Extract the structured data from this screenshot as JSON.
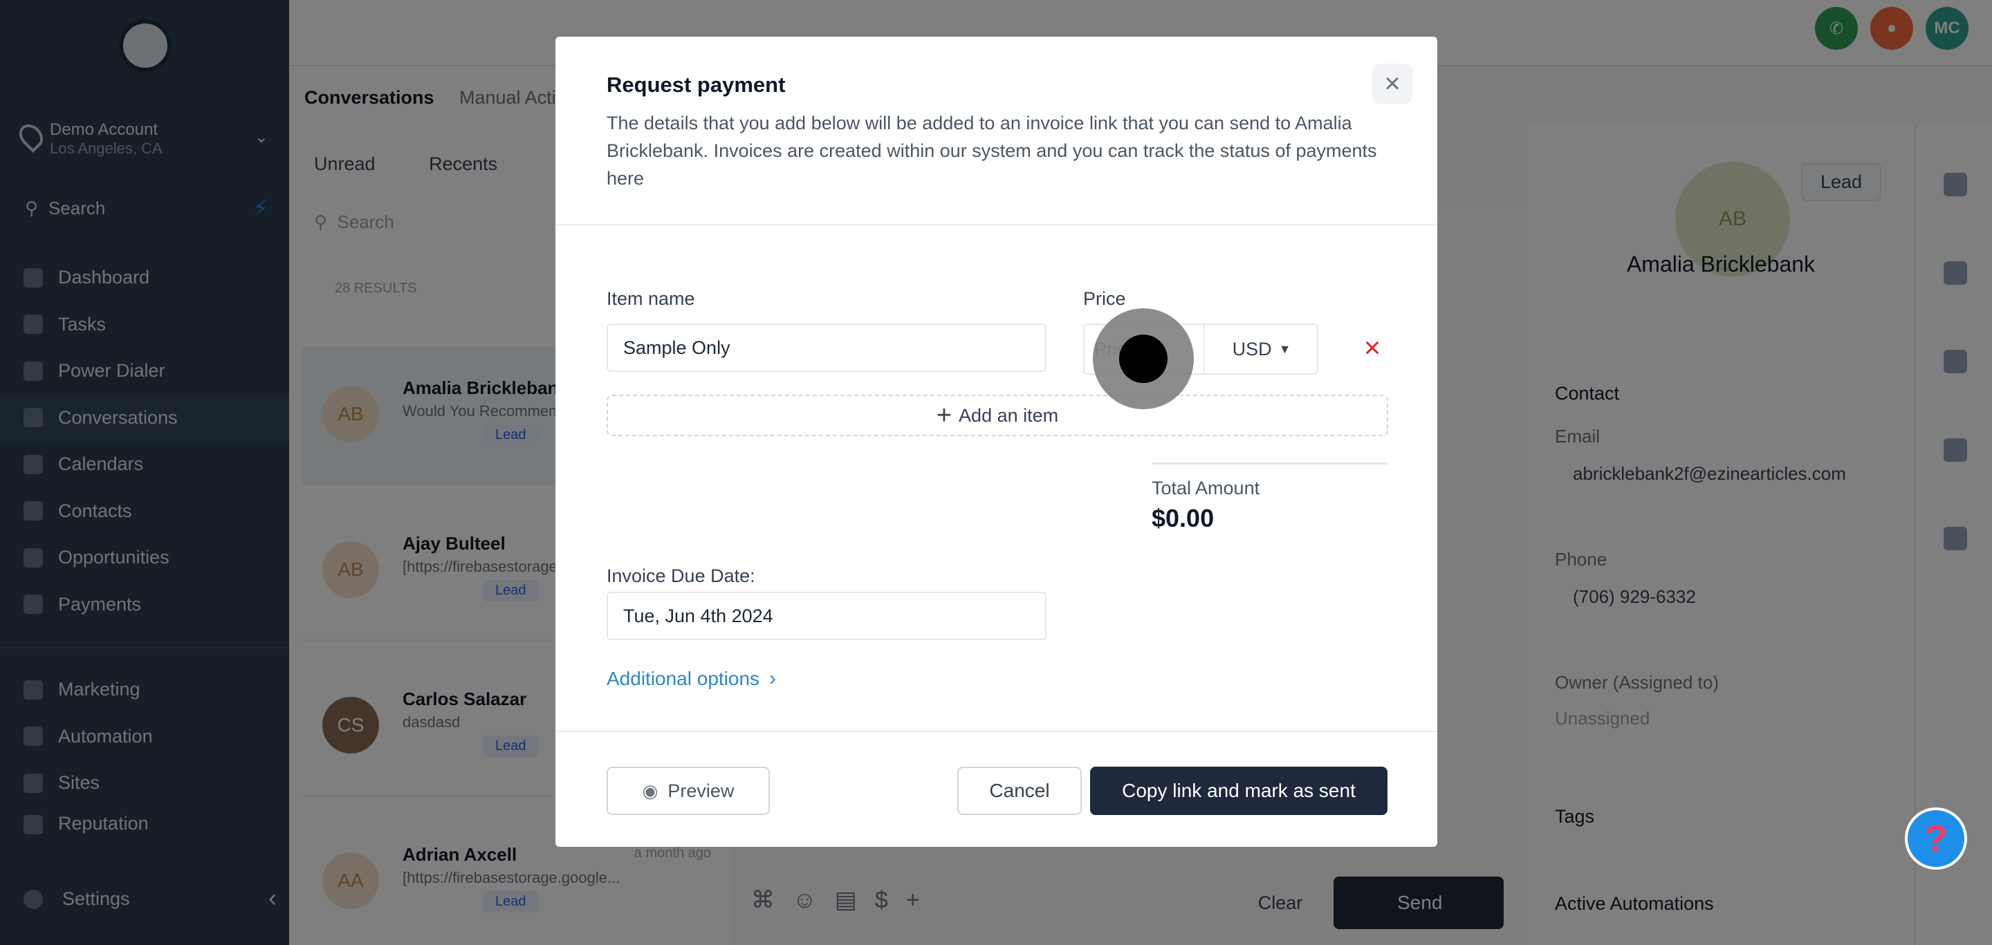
{
  "sidebar": {
    "account_name": "Demo Account",
    "account_location": "Los Angeles, CA",
    "search_placeholder": "Search",
    "nav_items": [
      "Dashboard",
      "Tasks",
      "Power Dialer",
      "Conversations",
      "Calendars",
      "Contacts",
      "Opportunities",
      "Payments"
    ],
    "nav_items_2": [
      "Marketing",
      "Automation",
      "Sites",
      "Reputation"
    ],
    "settings_label": "Settings"
  },
  "topbar": {
    "avatar_initials": "MC"
  },
  "conversations": {
    "title": "Conversations",
    "title_secondary": "Manual Actions",
    "tabs": [
      "Unread",
      "Recents"
    ],
    "search_placeholder": "Search",
    "results_count": "28 RESULTS",
    "items": [
      {
        "initials": "AB",
        "name": "Amalia Bricklebank",
        "message": "Would You Recommend",
        "tag": "Lead",
        "time": ""
      },
      {
        "initials": "AB",
        "name": "Ajay Bulteel",
        "message": "[https://firebasestorage",
        "tag": "Lead",
        "time": ""
      },
      {
        "initials": "CS",
        "name": "Carlos Salazar",
        "message": "dasdasd",
        "tag": "Lead",
        "time": ""
      },
      {
        "initials": "AA",
        "name": "Adrian Axcell",
        "message": "[https://firebasestorage.google...",
        "tag": "Lead",
        "time": "a month ago"
      }
    ]
  },
  "chat": {
    "clear_label": "Clear",
    "send_label": "Send"
  },
  "contact": {
    "initials": "AB",
    "lead_label": "Lead",
    "name": "Amalia Bricklebank",
    "contact_section": "Contact",
    "email_label": "Email",
    "email_value": "abricklebank2f@ezinearticles.com",
    "phone_label": "Phone",
    "phone_value": "(706) 929-6332",
    "owner_label": "Owner (Assigned to)",
    "owner_value": "Unassigned",
    "tags_section": "Tags",
    "automations_section": "Active Automations"
  },
  "modal": {
    "title": "Request payment",
    "description": "The details that you add below will be added to an invoice link that you can send to Amalia Bricklebank. Invoices are created within our system and you can track the status of payments here",
    "item_name_label": "Item name",
    "item_name_value": "Sample Only",
    "price_label": "Price",
    "price_placeholder": "Price",
    "currency": "USD",
    "add_item_label": "Add an item",
    "total_label": "Total Amount",
    "total_value": "$0.00",
    "due_date_label": "Invoice Due Date:",
    "due_date_value": "Tue, Jun 4th 2024",
    "additional_options_label": "Additional options",
    "preview_label": "Preview",
    "cancel_label": "Cancel",
    "confirm_label": "Copy link and mark as sent"
  },
  "help_label": "?",
  "colors": {
    "accent_dark": "#1e293b",
    "link": "#2b88c8",
    "danger": "#dc2626",
    "sidebar_bg": "#2c3e50"
  },
  "icons": [
    "location-pin-icon",
    "search-icon",
    "bolt-icon",
    "close-icon",
    "plus-icon",
    "chevron-down-icon",
    "chevron-right-icon",
    "eye-icon",
    "help-icon"
  ]
}
